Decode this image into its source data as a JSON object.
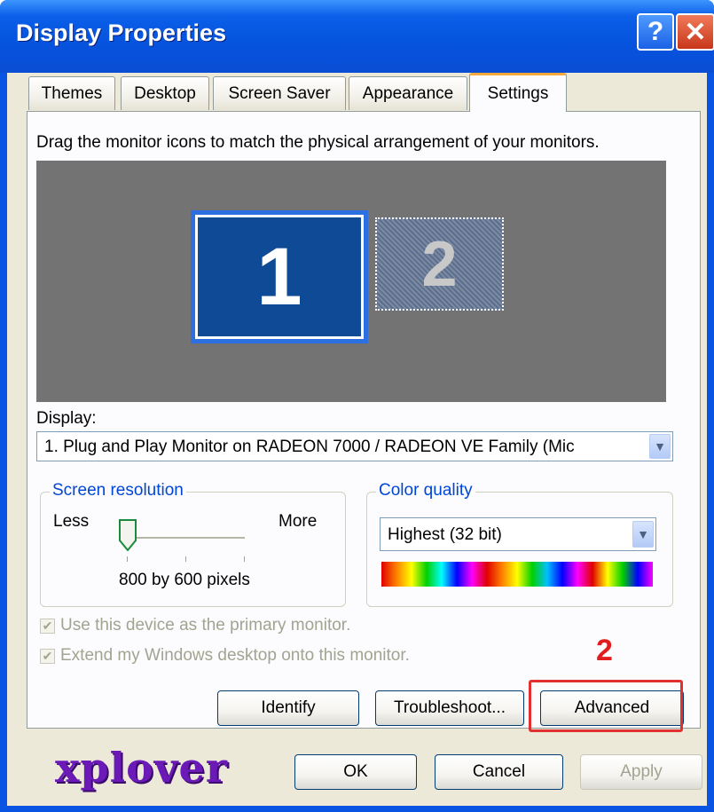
{
  "window": {
    "title": "Display Properties",
    "help_glyph": "?",
    "close_glyph": "✕"
  },
  "tabs": [
    {
      "label": "Themes"
    },
    {
      "label": "Desktop"
    },
    {
      "label": "Screen Saver"
    },
    {
      "label": "Appearance"
    },
    {
      "label": "Settings",
      "selected": true
    }
  ],
  "settings": {
    "instruction": "Drag the monitor icons to match the physical arrangement of your monitors.",
    "monitors": [
      {
        "number": "1",
        "active": true
      },
      {
        "number": "2",
        "active": false
      }
    ],
    "display_label": "Display:",
    "display_value": "1. Plug and Play Monitor on RADEON 7000 / RADEON VE Family (Mic",
    "screen_resolution": {
      "title": "Screen resolution",
      "less_label": "Less",
      "more_label": "More",
      "value_text": "800 by 600 pixels",
      "slider_position": 0.1
    },
    "color_quality": {
      "title": "Color quality",
      "value": "Highest (32 bit)"
    },
    "primary_monitor": {
      "label": "Use this device as the primary monitor.",
      "checked": true,
      "enabled": false
    },
    "extend_desktop": {
      "label": "Extend my Windows desktop onto this monitor.",
      "checked": true,
      "enabled": false
    },
    "buttons": {
      "identify": "Identify",
      "troubleshoot": "Troubleshoot...",
      "advanced": "Advanced"
    }
  },
  "footer": {
    "ok": "OK",
    "cancel": "Cancel",
    "apply": "Apply"
  },
  "annotation": {
    "step": "2",
    "color": "#e01e1e"
  },
  "watermark": "xplover",
  "colors": {
    "title_bar": "#0a54e3",
    "selected_tab_accent": "#f5a93a",
    "monitor_primary": "#0f4a97",
    "group_title": "#0046d5"
  }
}
